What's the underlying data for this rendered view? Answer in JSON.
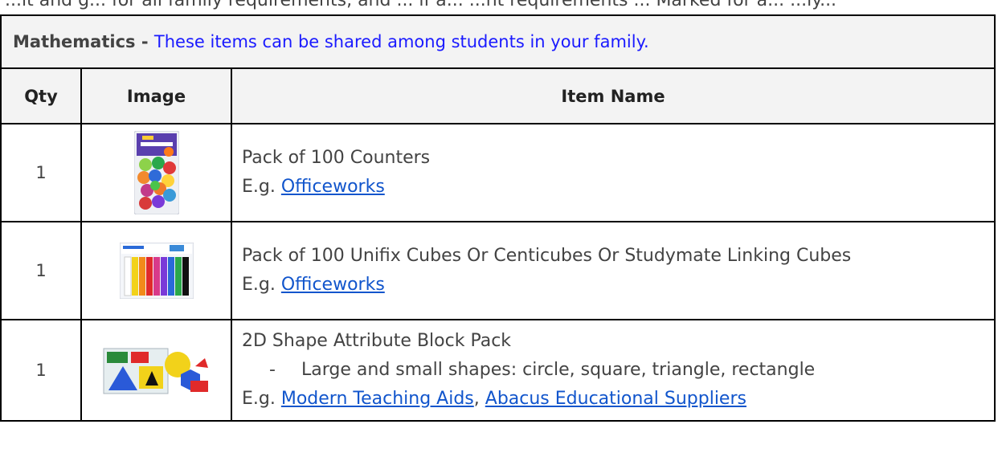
{
  "cut_text": "...lt and g... for all family requirements, and ... if a... ...nt requirements ... Marked for a... ...ly...",
  "section": {
    "title": "Mathematics",
    "separator": " - ",
    "note": "These items can be shared among students in your family."
  },
  "headers": {
    "qty": "Qty",
    "image": "Image",
    "item_name": "Item Name"
  },
  "items": [
    {
      "qty": "1",
      "image_icon": "counters-pack-image",
      "name": "Pack of 100 Counters",
      "eg_prefix": "E.g. ",
      "links": [
        "Officeworks"
      ]
    },
    {
      "qty": "1",
      "image_icon": "linking-cubes-image",
      "name": "Pack of 100 Unifix Cubes Or Centicubes Or Studymate Linking Cubes",
      "eg_prefix": "E.g. ",
      "links": [
        "Officeworks"
      ]
    },
    {
      "qty": "1",
      "image_icon": "attribute-blocks-image",
      "name": "2D Shape Attribute Block Pack",
      "bullet_dash": "-",
      "bullet": "Large and small shapes: circle, square, triangle, rectangle",
      "eg_prefix": "E.g. ",
      "links": [
        "Modern Teaching Aids",
        "Abacus Educational Suppliers"
      ],
      "link_sep": ", "
    }
  ],
  "colors": {
    "note": "#1a1aff",
    "link": "#1155cc",
    "header_bg": "#f3f3f3",
    "text": "#434343"
  }
}
